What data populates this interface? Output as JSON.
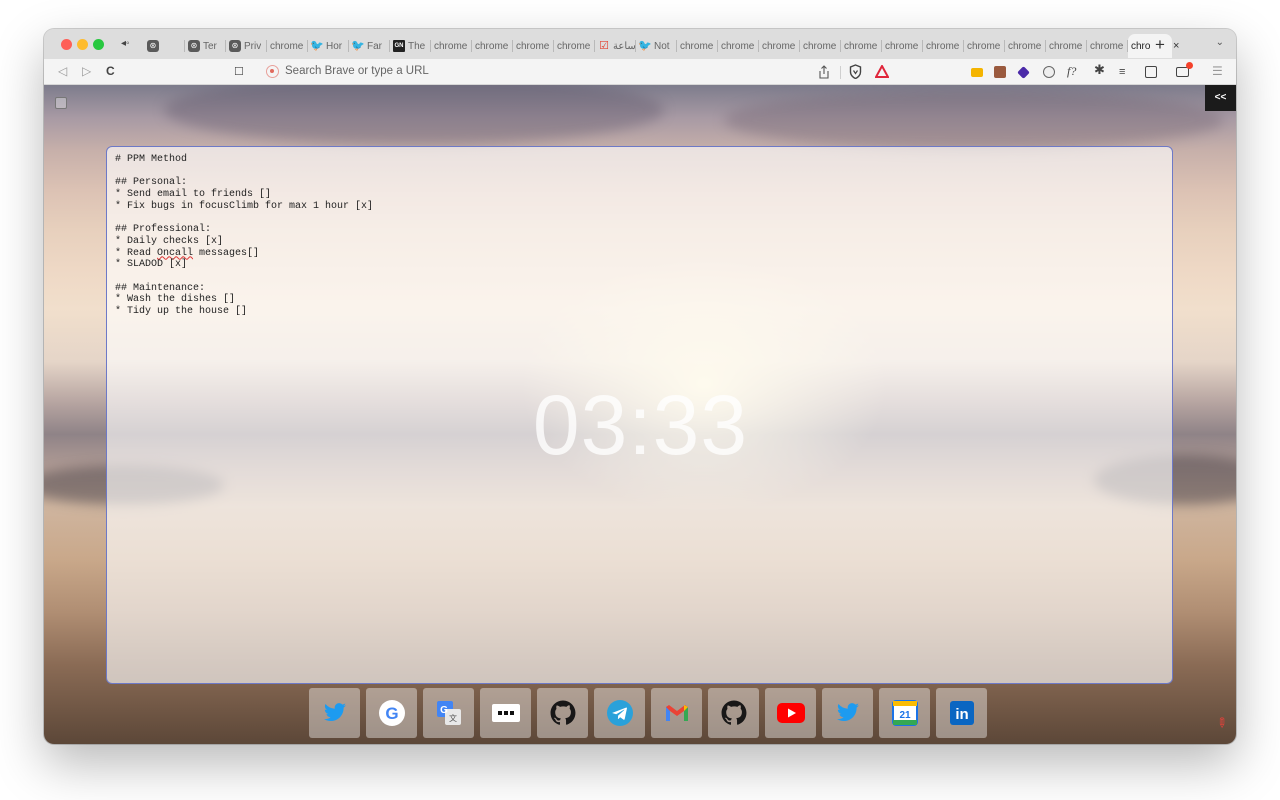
{
  "browser": {
    "tabs": [
      {
        "title": "",
        "icon": "chatgpt-icon"
      },
      {
        "title": "Ter",
        "icon": "chatgpt-icon"
      },
      {
        "title": "Priv",
        "icon": "chatgpt-icon"
      },
      {
        "title": "chrome",
        "icon": ""
      },
      {
        "title": "Hor",
        "icon": "twitter-icon"
      },
      {
        "title": "Far",
        "icon": "twitter-icon"
      },
      {
        "title": "The",
        "icon": "gn-icon"
      },
      {
        "title": "chrome",
        "icon": ""
      },
      {
        "title": "chrome",
        "icon": ""
      },
      {
        "title": "chrome",
        "icon": ""
      },
      {
        "title": "chrome",
        "icon": ""
      },
      {
        "title": "ساعة",
        "icon": "check-icon"
      },
      {
        "title": "Not",
        "icon": "twitter-icon"
      },
      {
        "title": "chrome",
        "icon": ""
      },
      {
        "title": "chrome",
        "icon": ""
      },
      {
        "title": "chrome",
        "icon": ""
      },
      {
        "title": "chrome",
        "icon": ""
      },
      {
        "title": "chrome",
        "icon": ""
      },
      {
        "title": "chrome",
        "icon": ""
      },
      {
        "title": "chrome",
        "icon": ""
      },
      {
        "title": "chrome",
        "icon": ""
      },
      {
        "title": "chrome",
        "icon": ""
      },
      {
        "title": "chrome",
        "icon": ""
      },
      {
        "title": "chrome",
        "icon": ""
      },
      {
        "title": "chro",
        "icon": "",
        "active": true
      }
    ],
    "close_tab": "×",
    "new_tab": "+",
    "tab_menu": "⌄",
    "back": "◁",
    "forward": "▷",
    "reload": "C",
    "bookmark": "☐",
    "search_placeholder": "Search Brave or type a URL",
    "menu": "☰"
  },
  "page": {
    "collapse_label": "<<",
    "note": {
      "lines_before": "# PPM Method\n\n## Personal:\n* Send email to friends []\n* Fix bugs in focusClimb for max 1 hour [x]\n\n## Professional:\n* Daily checks [x]\n* Read ",
      "misspelled_word": "Oncall",
      "lines_after": " messages[]\n* SLADOD [x]\n\n## Maintenance:\n* Wash the dishes []\n* Tidy up the house []"
    },
    "clock": "03:33",
    "dock": [
      {
        "name": "twitter-icon",
        "color": "#1d9bf0"
      },
      {
        "name": "google-icon",
        "color": "#4285f4"
      },
      {
        "name": "google-translate-icon",
        "color": "#4285f4"
      },
      {
        "name": "dots-app-icon",
        "color": "#111111"
      },
      {
        "name": "github-icon",
        "color": "#181717"
      },
      {
        "name": "telegram-icon",
        "color": "#2aa1da"
      },
      {
        "name": "gmail-icon",
        "color": "#ea4335"
      },
      {
        "name": "github-icon",
        "color": "#181717"
      },
      {
        "name": "youtube-icon",
        "color": "#ff0000"
      },
      {
        "name": "twitter-icon",
        "color": "#1d9bf0"
      },
      {
        "name": "google-calendar-icon",
        "color": "#1a73e8",
        "label": "21"
      },
      {
        "name": "linkedin-icon",
        "color": "#0a66c2",
        "label": "in"
      }
    ]
  }
}
